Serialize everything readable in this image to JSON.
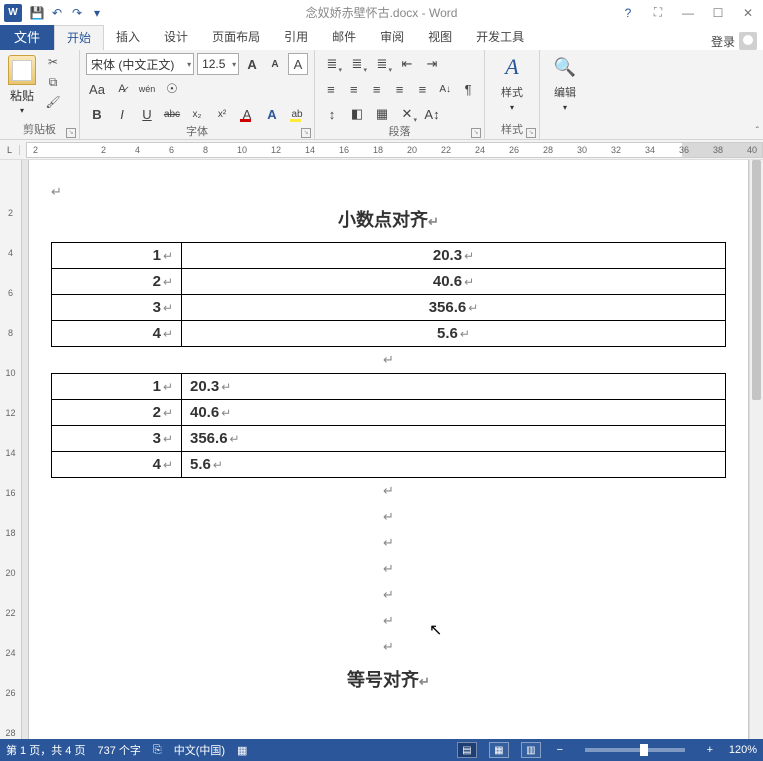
{
  "title": {
    "doc": "念奴娇赤壁怀古.docx",
    "app": "Word"
  },
  "qat": {
    "save": "💾",
    "undo": "↶",
    "redo": "↷",
    "custom": "▾"
  },
  "win": {
    "help": "?",
    "full": "⛶",
    "min": "—",
    "max": "☐",
    "close": "✕"
  },
  "tabs": {
    "file": "文件",
    "home": "开始",
    "insert": "插入",
    "design": "设计",
    "layout": "页面布局",
    "ref": "引用",
    "mail": "邮件",
    "review": "审阅",
    "view": "视图",
    "dev": "开发工具",
    "login": "登录"
  },
  "ribbon": {
    "clipboard": {
      "paste": "粘贴",
      "label": "剪贴板"
    },
    "font": {
      "family": "宋体 (中文正文)",
      "size": "12.5",
      "grow": "A",
      "shrink": "A",
      "change": "Aa",
      "clear": "⌫",
      "phon": "wén",
      "charbox": "A",
      "bold": "B",
      "italic": "I",
      "under": "U",
      "strike": "abc",
      "sub": "x₂",
      "sup": "x²",
      "effects": "A",
      "highlight": "ab",
      "color": "A",
      "label": "字体"
    },
    "para": {
      "bul": "≡",
      "num": "≡",
      "ml": "≡",
      "left": "≡",
      "center": "≡",
      "right": "≡",
      "just": "≡",
      "dec": "⇤",
      "inc": "⇥",
      "sort": "A↓",
      "marks": "¶",
      "spacing": "↕",
      "shade": "◧",
      "border": "▦",
      "label": "段落"
    },
    "styles": {
      "icon": "A",
      "label": "样式",
      "cap": "样式"
    },
    "edit": {
      "find": "🔍",
      "cap": "编辑",
      "label": ""
    }
  },
  "ruler": {
    "letter": "L",
    "ticks": [
      "2",
      "",
      "2",
      "4",
      "6",
      "8",
      "10",
      "12",
      "14",
      "16",
      "18",
      "20",
      "22",
      "24",
      "26",
      "28",
      "30",
      "32",
      "34",
      "36",
      "38",
      "40"
    ]
  },
  "vruler": [
    "",
    "2",
    "4",
    "6",
    "8",
    "10",
    "12",
    "14",
    "16",
    "18",
    "20",
    "22",
    "24",
    "26",
    "28"
  ],
  "doc": {
    "heading1": "小数点对齐",
    "heading2": "等号对齐",
    "table1": [
      {
        "a": "1",
        "b": "20.3"
      },
      {
        "a": "2",
        "b": "40.6"
      },
      {
        "a": "3",
        "b": "356.6"
      },
      {
        "a": "4",
        "b": "5.6"
      }
    ],
    "table2": [
      {
        "a": "1",
        "b": "20.3"
      },
      {
        "a": "2",
        "b": "40.6"
      },
      {
        "a": "3",
        "b": "356.6"
      },
      {
        "a": "4",
        "b": "5.6"
      }
    ]
  },
  "status": {
    "page": "第 1 页，共 4 页",
    "words": "737 个字",
    "proof": "⎘",
    "lang": "中文(中国)",
    "macro": "▦",
    "zoom": "120%"
  }
}
